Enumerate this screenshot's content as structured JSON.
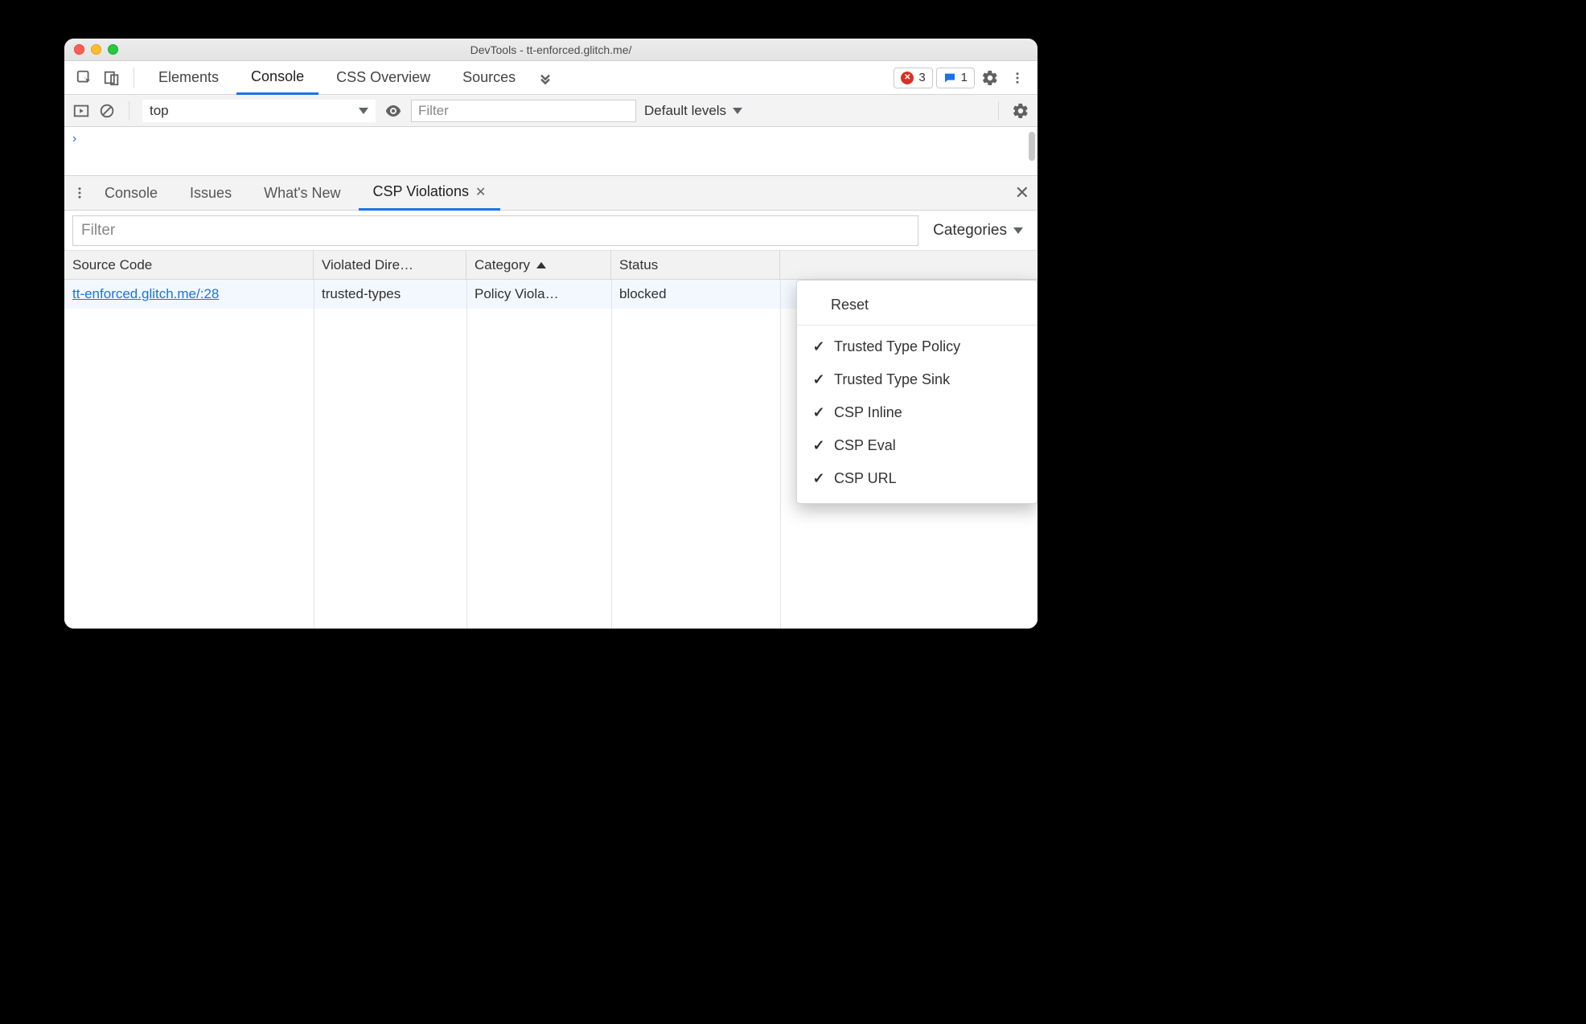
{
  "window": {
    "title": "DevTools - tt-enforced.glitch.me/"
  },
  "main_tabs": {
    "items": [
      "Elements",
      "Console",
      "CSS Overview",
      "Sources"
    ],
    "active": 1,
    "errors": "3",
    "messages": "1"
  },
  "console_toolbar": {
    "context": "top",
    "filter_placeholder": "Filter",
    "levels_label": "Default levels"
  },
  "drawer": {
    "tabs": [
      "Console",
      "Issues",
      "What's New",
      "CSP Violations"
    ],
    "active": 3
  },
  "filter_row": {
    "placeholder": "Filter",
    "categories_label": "Categories"
  },
  "table": {
    "headers": {
      "source": "Source Code",
      "directive": "Violated Dire…",
      "category": "Category",
      "status": "Status"
    },
    "rows": [
      {
        "source": "tt-enforced.glitch.me/:28",
        "directive": "trusted-types",
        "category": "Policy Viola…",
        "status": "blocked"
      }
    ]
  },
  "categories_menu": {
    "reset": "Reset",
    "items": [
      "Trusted Type Policy",
      "Trusted Type Sink",
      "CSP Inline",
      "CSP Eval",
      "CSP URL"
    ]
  }
}
